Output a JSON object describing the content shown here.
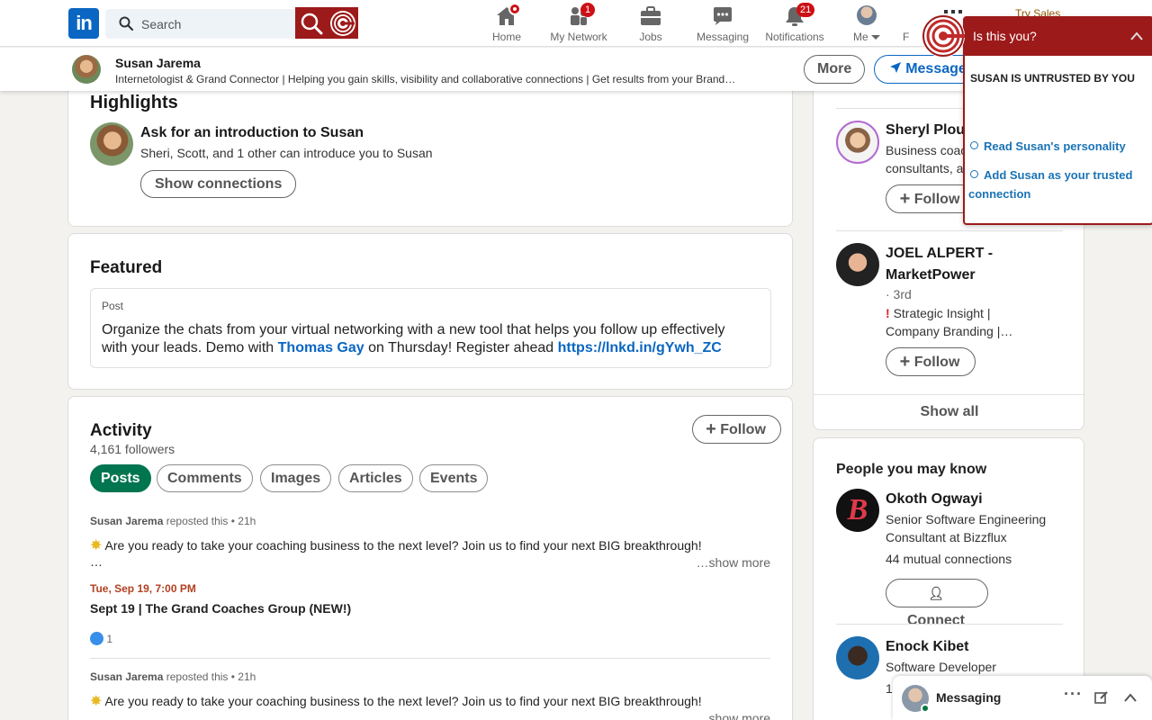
{
  "nav": {
    "search_placeholder": "Search",
    "items": [
      {
        "label": "Home"
      },
      {
        "label": "My Network",
        "badge": "1"
      },
      {
        "label": "Jobs"
      },
      {
        "label": "Messaging"
      },
      {
        "label": "Notifications",
        "badge": "21"
      },
      {
        "label": "Me"
      }
    ],
    "partial_label": "F",
    "try_sales": "Try Sales"
  },
  "profile_bar": {
    "name": "Susan Jarema",
    "headline": "Internetologist & Grand Connector | Helping you gain skills, visibility and collaborative connections | Get results from your Brand…",
    "more_label": "More",
    "message_label": "Message"
  },
  "highlights": {
    "title": "Highlights",
    "intro_title": "Ask for an introduction to Susan",
    "intro_sub": "Sheri, Scott, and 1 other can introduce you to Susan",
    "button": "Show connections"
  },
  "featured": {
    "title": "Featured",
    "post_label": "Post",
    "text_1": "Organize the chats from your virtual networking with a new tool that helps you follow up effectively",
    "text_2a": "with your leads. Demo with ",
    "mention": "Thomas Gay",
    "text_2b": " on Thursday! Register ahead ",
    "url": "https://lnkd.in/gYwh_ZC"
  },
  "activity": {
    "title": "Activity",
    "followers": "4,161 followers",
    "follow_label": "Follow",
    "tabs": [
      "Posts",
      "Comments",
      "Images",
      "Articles",
      "Events"
    ],
    "posts": [
      {
        "author": "Susan Jarema",
        "meta": " reposted this • 21h",
        "text": "Are you ready to take your coaching business to the next level? Join us to find your next BIG breakthrough!",
        "ellipsis": "…",
        "show_more": "…show more",
        "event_date": "Tue, Sep 19, 7:00 PM",
        "event_title": "Sept 19 | The Grand Coaches Group (NEW!)",
        "reactions": "1"
      },
      {
        "author": "Susan Jarema",
        "meta": " reposted this • 21h",
        "text": "Are you ready to take your coaching business to the next level? Join us to find your next BIG breakthrough!",
        "show_more": "…show more"
      }
    ]
  },
  "right_rail": {
    "people": [
      {
        "name": "Sheryl Plou",
        "line1": "Business coac",
        "line2": "consultants, a",
        "button": "Follow"
      },
      {
        "name_1": "JOEL ALPERT -",
        "name_2": "MarketPower",
        "degree": "· 3rd",
        "line1": "Strategic Insight |",
        "line2": "Company Branding |…",
        "button": "Follow"
      }
    ],
    "show_all": "Show all",
    "pymk_title": "People you may know",
    "pymk": [
      {
        "name": "Okoth Ogwayi",
        "line1": "Senior Software Engineering",
        "line2": "Consultant at Bizzflux",
        "mutual": "44 mutual connections",
        "button": "Connect"
      },
      {
        "name": "Enock Kibet",
        "line1": "Software Developer",
        "line2": "1"
      }
    ]
  },
  "popup": {
    "title": "Is this you?",
    "warning": "SUSAN IS UNTRUSTED BY YOU",
    "link_1": "Read Susan's personality",
    "link_2": "Add Susan as your trusted connection"
  },
  "messaging_dock": {
    "label": "Messaging"
  },
  "colors": {
    "brand": "#0a66c2",
    "extension": "#9d1a1a",
    "active_tab": "#01754f",
    "badge": "#cc1016"
  }
}
